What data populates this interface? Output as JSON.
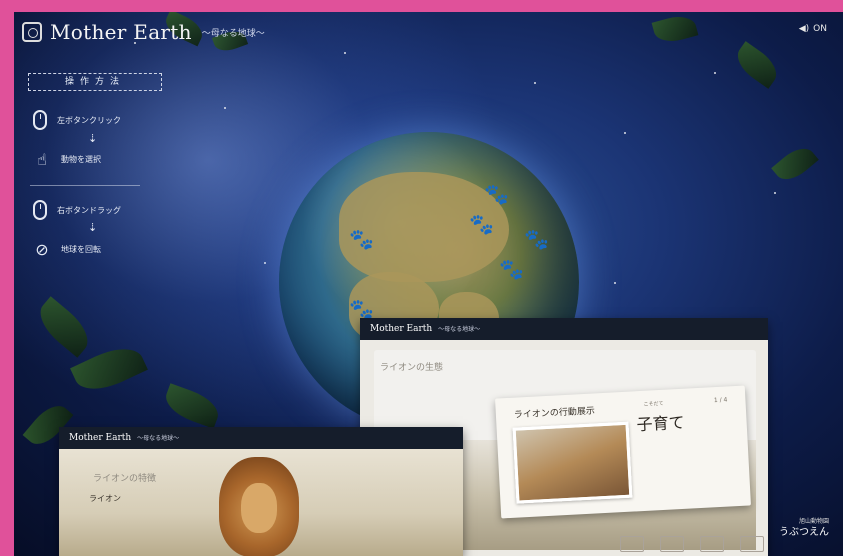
{
  "header": {
    "title": "Mother Earth",
    "subtitle": "〜母なる地球〜"
  },
  "sound": {
    "label": "ON"
  },
  "howto": {
    "title": "操作方法",
    "steps": [
      {
        "label": "左ボタンクリック"
      },
      {
        "label": "動物を選択"
      },
      {
        "label": "右ボタンドラッグ"
      },
      {
        "label": "地球を回転"
      }
    ]
  },
  "card_a": {
    "brand": "Mother Earth",
    "brand_sub": "〜母なる地球〜",
    "panel_heading": "ライオンの生態",
    "inner_title": "ライオンの行動展示",
    "inner_heading": "子育て",
    "inner_ruby": "こそだて",
    "pager": "1 / 4"
  },
  "card_b": {
    "brand": "Mother Earth",
    "brand_sub": "〜母なる地球〜",
    "heading": "ライオンの特徴",
    "name": "ライオン"
  },
  "zoo": {
    "line1": "旭山動物園",
    "line2": "うぶつえん"
  }
}
